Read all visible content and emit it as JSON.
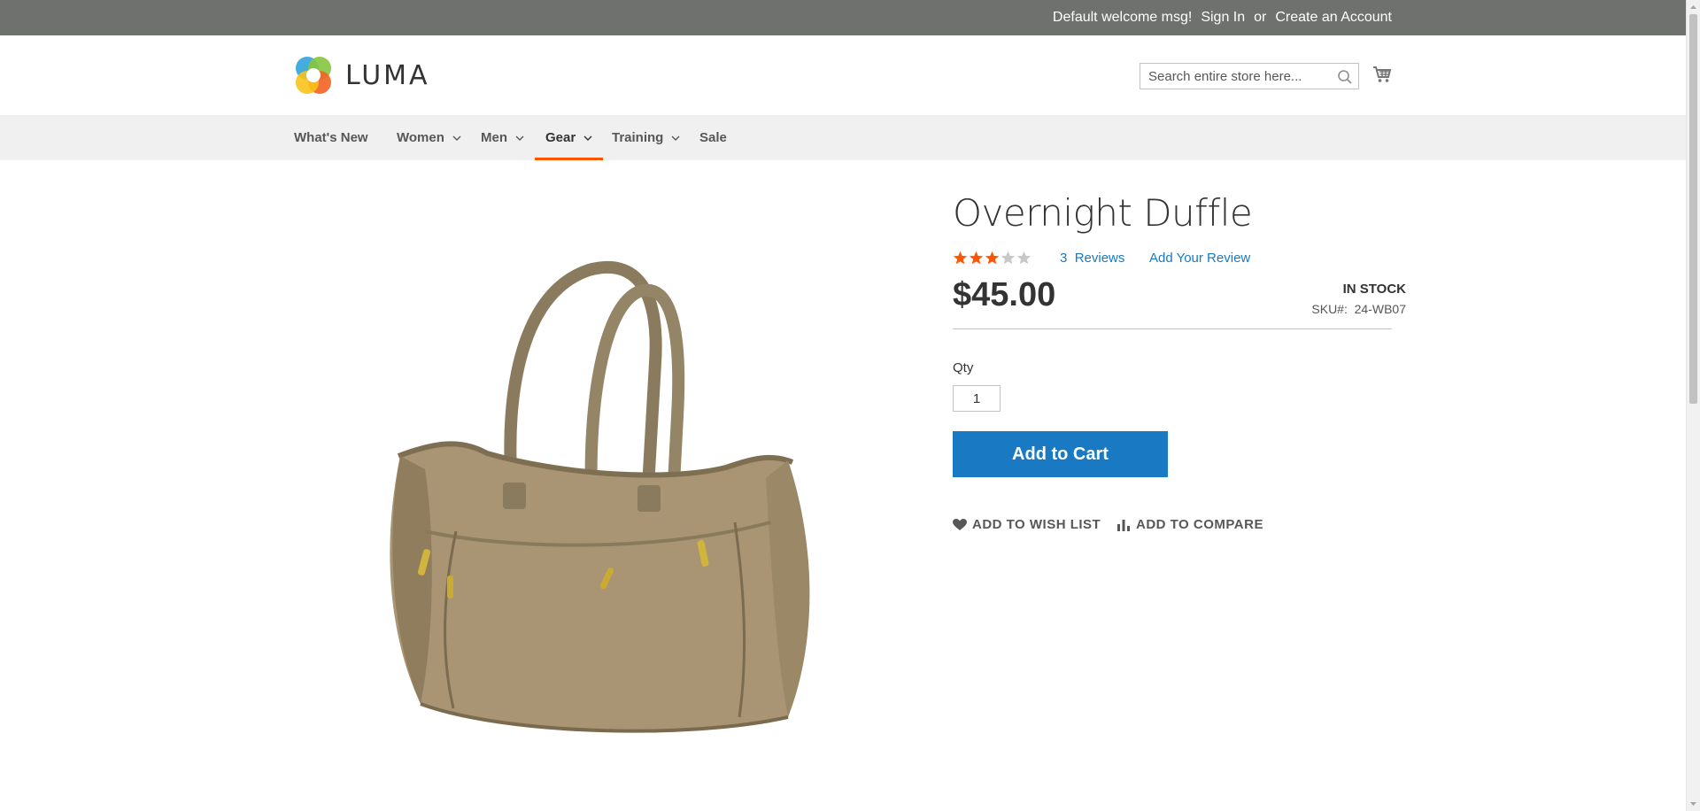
{
  "topbar": {
    "welcome": "Default welcome msg!",
    "sign_in": "Sign In",
    "or": "or",
    "create_account": "Create an Account",
    "background": "#6e716e"
  },
  "header": {
    "logo_text": "LUMA",
    "search_placeholder": "Search entire store here...",
    "search_icon": "search-icon",
    "cart_icon": "cart-icon"
  },
  "nav": {
    "items": [
      {
        "label": "What's New",
        "has_dropdown": false
      },
      {
        "label": "Women",
        "has_dropdown": true
      },
      {
        "label": "Men",
        "has_dropdown": true
      },
      {
        "label": "Gear",
        "has_dropdown": true,
        "active": true
      },
      {
        "label": "Training",
        "has_dropdown": true
      },
      {
        "label": "Sale",
        "has_dropdown": false
      }
    ],
    "active_color": "#ff5501"
  },
  "product": {
    "title": "Overnight Duffle",
    "rating_stars": 3,
    "rating_max": 5,
    "reviews_count": "3",
    "reviews_label": "Reviews",
    "add_review": "Add Your Review",
    "price": "$45.00",
    "stock": "In stock",
    "sku_label": "SKU#:",
    "sku": "24-WB07",
    "qty_label": "Qty",
    "qty_value": "1",
    "add_to_cart": "Add to Cart",
    "add_to_wishlist": "Add to Wish List",
    "add_to_compare": "Add to Compare",
    "accent_color": "#1979c3",
    "star_color": "#ff5501"
  }
}
